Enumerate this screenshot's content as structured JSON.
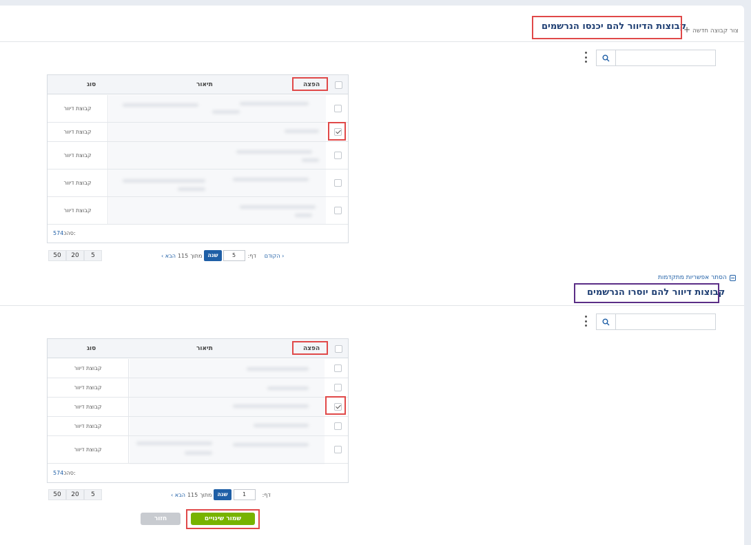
{
  "section1": {
    "title": "קבוצות הדיוור להם יכנסו הנרשמים",
    "create_link": "צור קבוצה חדשה",
    "plus": "+"
  },
  "section2": {
    "title": "קבוצות דיוור להם יוסרו הנרשמים",
    "hide_advanced": "הסתר אפשריות מתקדמות"
  },
  "grid_headers": {
    "distribution": "הפצה",
    "description": "תיאור",
    "type": "סוג"
  },
  "grid1": {
    "rows": [
      {
        "type": "קבוצת דיוור",
        "checked": false
      },
      {
        "type": "קבוצת דיוור",
        "checked": true
      },
      {
        "type": "קבוצת דיוור",
        "checked": false
      },
      {
        "type": "קבוצת דיוור",
        "checked": false
      },
      {
        "type": "קבוצת דיוור",
        "checked": false
      }
    ],
    "total_label": "סהכ:",
    "total_value": "574"
  },
  "grid2": {
    "rows": [
      {
        "type": "קבוצת דיוור",
        "checked": false
      },
      {
        "type": "קבוצת דיוור",
        "checked": false
      },
      {
        "type": "קבוצת דיוור",
        "checked": true
      },
      {
        "type": "קבוצת דיוור",
        "checked": false
      },
      {
        "type": "קבוצת דיוור",
        "checked": false
      }
    ],
    "total_label": "סהכ:",
    "total_value": "574"
  },
  "pager1": {
    "prev": "הקודם",
    "page_label": "דף:",
    "page_value": "5",
    "go": "שנה",
    "of": "מתוך",
    "total_pages": "115",
    "next": "הבא"
  },
  "pager2": {
    "page_label": "דף:",
    "page_value": "1",
    "go": "שנה",
    "of": "מתוך",
    "total_pages": "115",
    "next": "הבא"
  },
  "page_sizes": [
    "50",
    "20",
    "5"
  ],
  "buttons": {
    "save": "שמור שינויים",
    "back": "חזור"
  }
}
